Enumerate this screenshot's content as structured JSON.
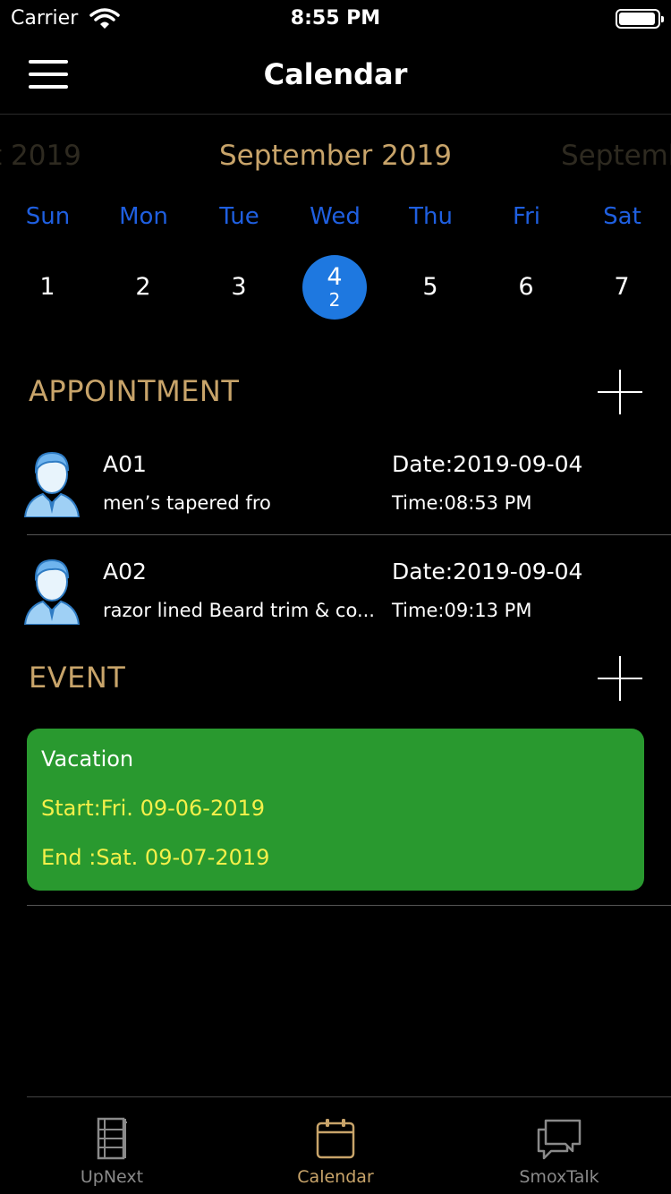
{
  "status_bar": {
    "carrier": "Carrier",
    "time": "8:55 PM",
    "battery_level": 0.95
  },
  "nav": {
    "title": "Calendar"
  },
  "calendar": {
    "prev_month": "t 2019",
    "current_month": "September 2019",
    "next_month": "Septemb",
    "weekdays": [
      "Sun",
      "Mon",
      "Tue",
      "Wed",
      "Thu",
      "Fri",
      "Sat"
    ],
    "days": [
      "1",
      "2",
      "3",
      "4",
      "5",
      "6",
      "7"
    ],
    "selected_day": "4",
    "selected_count": "2"
  },
  "appointments": {
    "title": "APPOINTMENT",
    "items": [
      {
        "code": "A01",
        "service": "men’s tapered fro",
        "date": "Date:2019-09-04",
        "time": "Time:08:53 PM"
      },
      {
        "code": "A02",
        "service": "razor lined Beard trim & co...",
        "date": "Date:2019-09-04",
        "time": "Time:09:13 PM"
      }
    ]
  },
  "events": {
    "title": "EVENT",
    "items": [
      {
        "name": "Vacation",
        "start": "Start:Fri. 09-06-2019",
        "end": "End :Sat. 09-07-2019"
      }
    ]
  },
  "tabs": [
    {
      "label": "UpNext",
      "icon": "film-strip-icon",
      "active": false
    },
    {
      "label": "Calendar",
      "icon": "calendar-icon",
      "active": true
    },
    {
      "label": "SmoxTalk",
      "icon": "chat-bubbles-icon",
      "active": false
    }
  ],
  "colors": {
    "accent_gold": "#c8a46a",
    "weekday_blue": "#1f5fe0",
    "selected_blue": "#1e78e0",
    "event_green": "#29992f",
    "event_yellow": "#f5f04a"
  }
}
